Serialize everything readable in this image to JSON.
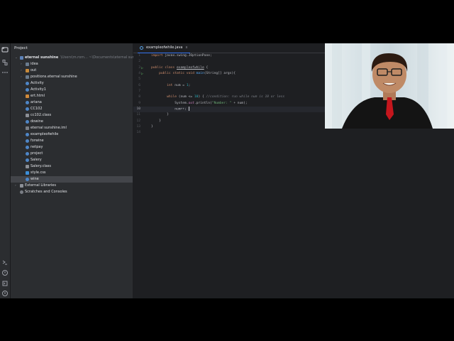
{
  "project_panel": {
    "title": "Project",
    "root": {
      "name": "eternal sunshine",
      "hint": "\\Users\\m.rom... ~\\Documents\\eternal sunshine"
    },
    "items": [
      {
        "label": "idea",
        "kind": "folder"
      },
      {
        "label": "out",
        "kind": "folder-excluded"
      },
      {
        "label": "positions.eternal sunshine",
        "kind": "folder"
      },
      {
        "label": "Activity",
        "kind": "java"
      },
      {
        "label": "Activity1",
        "kind": "java"
      },
      {
        "label": "ert.html",
        "kind": "html"
      },
      {
        "label": "ariana",
        "kind": "java"
      },
      {
        "label": "CC102",
        "kind": "java"
      },
      {
        "label": "cc102.class",
        "kind": "class"
      },
      {
        "label": "dowine",
        "kind": "java"
      },
      {
        "label": "eternal sunshine.iml",
        "kind": "iml"
      },
      {
        "label": "exampleofwhile",
        "kind": "java"
      },
      {
        "label": "forwine",
        "kind": "java"
      },
      {
        "label": "netpay",
        "kind": "java"
      },
      {
        "label": "project",
        "kind": "java"
      },
      {
        "label": "Salery",
        "kind": "java"
      },
      {
        "label": "Salery.class",
        "kind": "class"
      },
      {
        "label": "style.css",
        "kind": "css"
      },
      {
        "label": "wine",
        "kind": "java",
        "selected": true
      }
    ],
    "external_libraries": "External Libraries",
    "scratches": "Scratches and Consoles"
  },
  "editor": {
    "tab_label": "exampleofwhile.java",
    "tab_close": "x",
    "current_line": 10,
    "line_numbers": [
      "1",
      "2",
      "3",
      "4",
      "5",
      "6",
      "7",
      "8",
      "9",
      "10",
      "11",
      "12",
      "13",
      "14"
    ],
    "code": {
      "import_kw": "import",
      "import_path": " javax.swing.JOptionPane;",
      "class_decl_kw": "public class",
      "class_name": "exampleofwhile",
      "class_open": " {",
      "main_kw": "public static void",
      "main_name": "main",
      "main_args": "(String[] args){",
      "int_kw": "int",
      "num_decl": " num = ",
      "num_init": "1",
      "num_end": ";",
      "while_kw": "while",
      "while_cond_a": " (num <= ",
      "while_cond_n": "10",
      "while_cond_b": ") { ",
      "while_comment": "//condition: run while num is 10 or less",
      "sys": "System.",
      "sys_out": "out",
      "println": ".println(",
      "string_lit": "\"Number: \"",
      "println_end": " + num);",
      "incr": "num++;",
      "close_brace": "}"
    }
  },
  "colors": {
    "accent": "#3574f0",
    "keyword": "#cf8e6d",
    "string": "#6aab73",
    "comment": "#7a7e85",
    "number": "#2aacb8",
    "method": "#56a8f5",
    "static_field": "#c77dbb",
    "editor_bg": "#1e1f22",
    "panel_bg": "#2b2d30"
  },
  "icons": [
    "folder-icon",
    "structure-icon",
    "more-icon",
    "run-gutter-icon",
    "terminal-icon",
    "problems-icon",
    "git-icon",
    "notification-icon"
  ]
}
